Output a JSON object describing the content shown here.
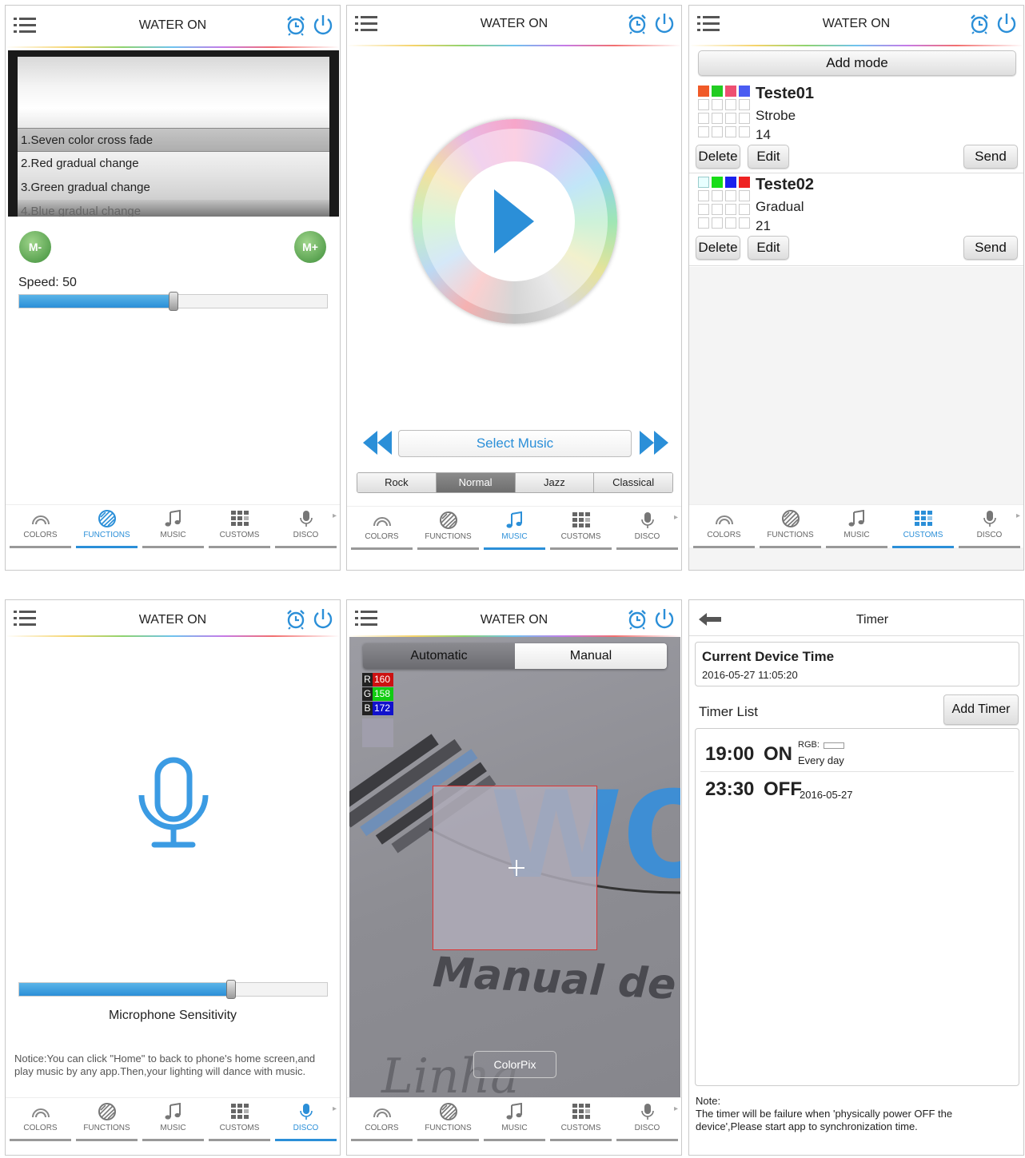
{
  "app_title": "WATER ON",
  "tabs": [
    "COLORS",
    "FUNCTIONS",
    "MUSIC",
    "CUSTOMS",
    "DISCO"
  ],
  "accent_color": "#2b8fd8",
  "functions": {
    "modes": [
      "1.Seven color cross fade",
      "2.Red gradual change",
      "3.Green gradual change",
      "4.Blue gradual change"
    ],
    "m_minus": "M-",
    "m_plus": "M+",
    "speed_label": "Speed: 50",
    "speed_value": 50
  },
  "music": {
    "select_music": "Select Music",
    "genres": [
      "Rock",
      "Normal",
      "Jazz",
      "Classical"
    ],
    "selected_genre": "Normal"
  },
  "customs": {
    "add_mode": "Add mode",
    "items": [
      {
        "name": "Teste01",
        "mode": "Strobe",
        "speed": "14",
        "colors": [
          "#f05a28",
          "#22cc22",
          "#ee4f72",
          "#4a5cf2"
        ]
      },
      {
        "name": "Teste02",
        "mode": "Gradual",
        "speed": "21",
        "colors": [
          "#e8ffff",
          "#18dd18",
          "#1b22ee",
          "#ee2222"
        ]
      }
    ],
    "delete_label": "Delete",
    "edit_label": "Edit",
    "send_label": "Send"
  },
  "disco": {
    "sensitivity_label": "Microphone Sensitivity",
    "sensitivity_value": 0.69,
    "notice": "Notice:You can click \"Home\" to back to phone's home screen,and play music by any app.Then,your lighting will dance with music."
  },
  "colorpix": {
    "automatic": "Automatic",
    "manual": "Manual",
    "r_label": "R",
    "r_value": "160",
    "g_label": "G",
    "g_value": "158",
    "b_label": "B",
    "b_value": "172",
    "bg_text_1": "WO",
    "bg_text_2": "Manual de",
    "bg_text_3": "Linha",
    "colorpix_button": "ColorPix"
  },
  "timer": {
    "title": "Timer",
    "current_time_heading": "Current Device Time",
    "current_time": "2016-05-27 11:05:20",
    "timer_list_label": "Timer List",
    "add_timer": "Add Timer",
    "timer1_time": "19:00",
    "timer1_state": "ON",
    "timer1_rgb_label": "RGB:",
    "timer1_repeat": "Every day",
    "timer2_time": "23:30",
    "timer2_state": "OFF",
    "timer2_date": "2016-05-27",
    "note_label": "Note:",
    "note_text": "The timer will be failure when 'physically power OFF the device',Please start app to synchronization time."
  }
}
